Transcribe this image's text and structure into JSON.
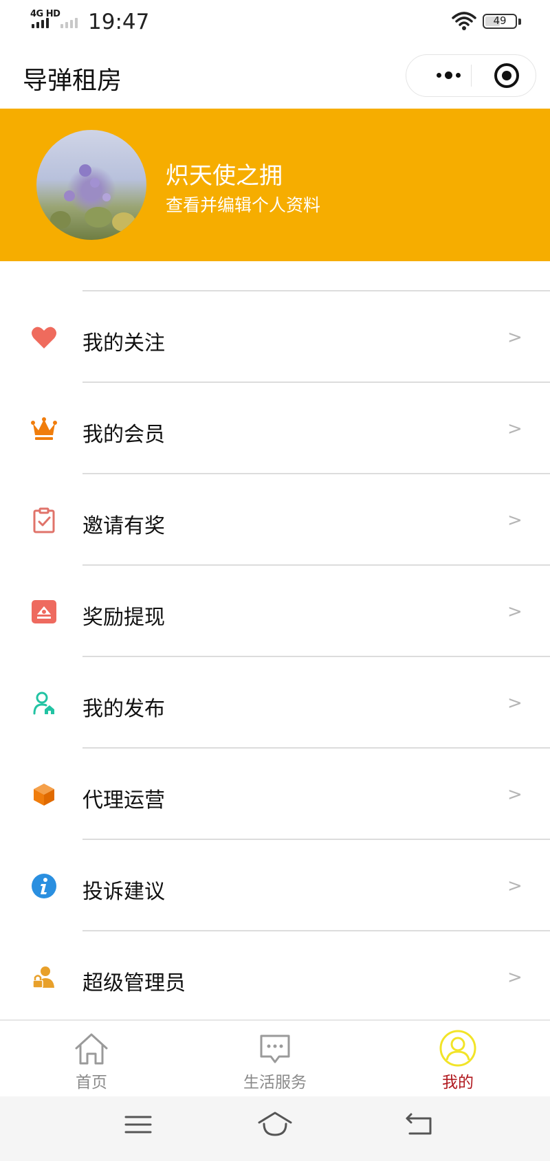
{
  "status_bar": {
    "network": "4G HD",
    "time": "19:47",
    "battery": "49"
  },
  "nav_bar": {
    "title": "导弹租房"
  },
  "profile": {
    "name": "炽天使之拥",
    "subtitle": "查看并编辑个人资料"
  },
  "menu": {
    "items": [
      {
        "label": "我的关注",
        "icon": "heart-icon",
        "color": "#ef6b5d",
        "arrow": ">"
      },
      {
        "label": "我的会员",
        "icon": "crown-icon",
        "color": "#f07d0c",
        "arrow": ">"
      },
      {
        "label": "邀请有奖",
        "icon": "clipboard-check-icon",
        "color": "#e0736a",
        "arrow": ">"
      },
      {
        "label": "奖励提现",
        "icon": "withdraw-icon",
        "color": "#ee6a5f",
        "arrow": ">"
      },
      {
        "label": "我的发布",
        "icon": "user-home-icon",
        "color": "#22c3a3",
        "arrow": ">"
      },
      {
        "label": "代理运营",
        "icon": "cube-icon",
        "color": "#f07d0c",
        "arrow": ">"
      },
      {
        "label": "投诉建议",
        "icon": "info-icon",
        "color": "#2a8fe0",
        "arrow": ">"
      },
      {
        "label": "超级管理员",
        "icon": "admin-lock-icon",
        "color": "#e8a02a",
        "arrow": ">"
      }
    ]
  },
  "tab_bar": {
    "tabs": [
      {
        "label": "首页",
        "icon": "home-icon"
      },
      {
        "label": "生活服务",
        "icon": "chat-icon"
      },
      {
        "label": "我的",
        "icon": "user-icon",
        "active": true
      }
    ]
  },
  "colors": {
    "banner": "#f6ad00",
    "active_tab": "#b0181e",
    "active_icon": "#f2e428"
  }
}
